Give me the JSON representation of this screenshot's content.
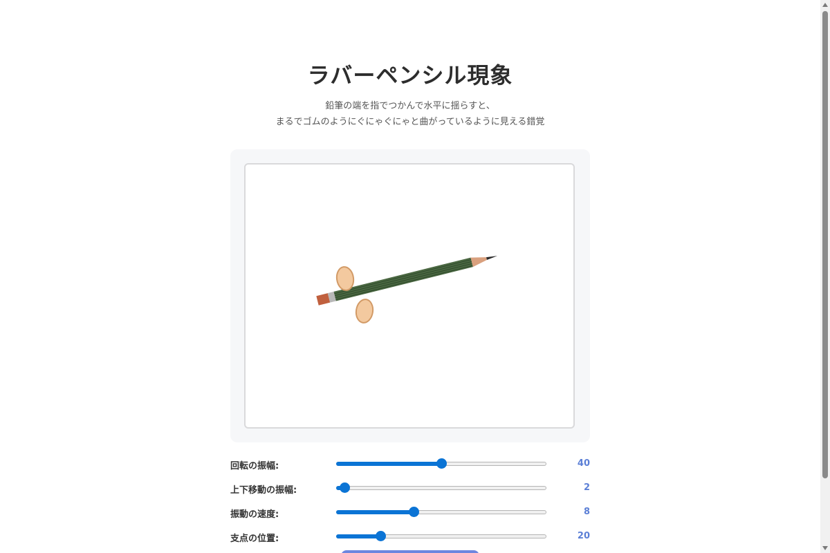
{
  "header": {
    "title": "ラバーペンシル現象",
    "subtitle_lines": [
      "鉛筆の端を指でつかんで水平に揺らすと、",
      "まるでゴムのようにぐにゃぐにゃと曲がっているように見える錯覚"
    ]
  },
  "canvas": {
    "icons": [
      "pencil-icon",
      "finger-icon"
    ],
    "colors": {
      "pencil_body": "#4a6741",
      "pencil_stripe": "#2f4a2c",
      "eraser": "#c0603e",
      "ferrule": "#b8b8b8",
      "wood_tip": "#d9a07e",
      "lead": "#2b2b2b",
      "finger_fill": "#f3c99f",
      "finger_stroke": "#d29a66"
    }
  },
  "controls": [
    {
      "label": "回転の振幅:",
      "value": "40",
      "fraction": 0.5
    },
    {
      "label": "上下移動の振幅:",
      "value": "2",
      "fraction": 0.04
    },
    {
      "label": "振動の速度:",
      "value": "8",
      "fraction": 0.37
    },
    {
      "label": "支点の位置:",
      "value": "20",
      "fraction": 0.21
    }
  ],
  "accent_color": "#0b74d5"
}
